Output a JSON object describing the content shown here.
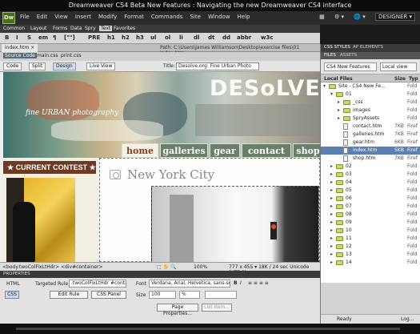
{
  "window": {
    "title": "Dreamweaver CS4 Beta New Features : Navigating the new Dreamweaver CS4 interface"
  },
  "menubar": {
    "logo": "Dw",
    "items": [
      "File",
      "Edit",
      "View",
      "Insert",
      "Modify",
      "Format",
      "Commands",
      "Site",
      "Window",
      "Help"
    ],
    "workspace": "DESIGNER ▾"
  },
  "insert_tabs": [
    "Common",
    "Layout",
    "Forms",
    "Data",
    "Spry",
    "Text",
    "Favorites"
  ],
  "insert_active": "Text",
  "insert_buttons": [
    "B",
    "I",
    "S",
    "em",
    "¶",
    "[\"\"]",
    "PRE",
    "h1",
    "h2",
    "h3",
    "ul",
    "ol",
    "li",
    "dl",
    "dt",
    "dd",
    "abbr",
    "w3c"
  ],
  "document": {
    "tab": "index.htm ×",
    "path": "Path: C:\\Users\\James Williamson\\Desktop\\exercise files\\01 index.htm",
    "related_files": [
      "Source Code",
      "main.css",
      "print.css"
    ],
    "view_buttons": [
      "Code",
      "Split",
      "Design",
      "Live View"
    ],
    "title_label": "Title:",
    "title_value": "Desolve.org: Fine Urban Photo"
  },
  "page": {
    "brand": "DESoLVE",
    "tagline": "fine URBAN photography",
    "nav": [
      "home",
      "galleries",
      "gear",
      "contact",
      "shop"
    ],
    "nav_current": "home",
    "contest_heading": "★ CURRENT CONTEST ★",
    "main_heading": "New York City"
  },
  "statusbar": {
    "tag_selector": "<body.twoColFixLtHdr> <div#container>",
    "zoom": "100%",
    "size": "777 x 455 ▾ 18K / 24 sec Unicode (UTF-8)"
  },
  "properties": {
    "header": "PROPERTIES",
    "html_label": "HTML",
    "css_label": "CSS",
    "targeted_rule_label": "Targeted Rule",
    "targeted_rule_value": ".twoColFixLtHdr #conta",
    "edit_rule": "Edit Rule",
    "css_panel": "CSS Panel",
    "font_label": "Font",
    "font_value": "Verdana, Arial, Helvetica, sans-serif",
    "size_label": "Size",
    "size_value": "100",
    "size_unit": "%",
    "page_properties": "Page Properties...",
    "list_item": "List Item..."
  },
  "panels": {
    "tabs": [
      "CSS STYLES",
      "AP ELEMENTS"
    ],
    "files_tabs": [
      "FILES",
      "ASSETS"
    ],
    "site_select": "CS4 New Features",
    "view_select": "Local view",
    "columns": [
      "Local Files",
      "Size",
      "Typ"
    ],
    "files": [
      {
        "name": "Site - CS4 New Fe...",
        "size": "",
        "type": "Fold",
        "indent": 0,
        "kind": "folder",
        "toggle": "▾"
      },
      {
        "name": "01",
        "size": "",
        "type": "Fold",
        "indent": 1,
        "kind": "folder",
        "toggle": "▾"
      },
      {
        "name": "_css",
        "size": "",
        "type": "Fold",
        "indent": 2,
        "kind": "folder",
        "toggle": "▸"
      },
      {
        "name": "images",
        "size": "",
        "type": "Fold",
        "indent": 2,
        "kind": "folder",
        "toggle": "▸"
      },
      {
        "name": "SpryAssets",
        "size": "",
        "type": "Fold",
        "indent": 2,
        "kind": "folder",
        "toggle": "▸"
      },
      {
        "name": "contact.htm",
        "size": "7KB",
        "type": "Firef",
        "indent": 2,
        "kind": "file",
        "toggle": ""
      },
      {
        "name": "galleries.htm",
        "size": "7KB",
        "type": "Firef",
        "indent": 2,
        "kind": "file",
        "toggle": ""
      },
      {
        "name": "gear.htm",
        "size": "6KB",
        "type": "Firef",
        "indent": 2,
        "kind": "file",
        "toggle": ""
      },
      {
        "name": "index.htm",
        "size": "5KB",
        "type": "Firef",
        "indent": 2,
        "kind": "file",
        "toggle": "",
        "selected": true
      },
      {
        "name": "shop.htm",
        "size": "7KB",
        "type": "Firef",
        "indent": 2,
        "kind": "file",
        "toggle": ""
      },
      {
        "name": "02",
        "size": "",
        "type": "Fold",
        "indent": 1,
        "kind": "folder",
        "toggle": "▸"
      },
      {
        "name": "03",
        "size": "",
        "type": "Fold",
        "indent": 1,
        "kind": "folder",
        "toggle": "▸"
      },
      {
        "name": "04",
        "size": "",
        "type": "Fold",
        "indent": 1,
        "kind": "folder",
        "toggle": "▸"
      },
      {
        "name": "05",
        "size": "",
        "type": "Fold",
        "indent": 1,
        "kind": "folder",
        "toggle": "▸"
      },
      {
        "name": "06",
        "size": "",
        "type": "Fold",
        "indent": 1,
        "kind": "folder",
        "toggle": "▸"
      },
      {
        "name": "07",
        "size": "",
        "type": "Fold",
        "indent": 1,
        "kind": "folder",
        "toggle": "▸"
      },
      {
        "name": "08",
        "size": "",
        "type": "Fold",
        "indent": 1,
        "kind": "folder",
        "toggle": "▸"
      },
      {
        "name": "09",
        "size": "",
        "type": "Fold",
        "indent": 1,
        "kind": "folder",
        "toggle": "▸"
      },
      {
        "name": "10",
        "size": "",
        "type": "Fold",
        "indent": 1,
        "kind": "folder",
        "toggle": "▸"
      },
      {
        "name": "11",
        "size": "",
        "type": "Fold",
        "indent": 1,
        "kind": "folder",
        "toggle": "▸"
      },
      {
        "name": "12",
        "size": "",
        "type": "Fold",
        "indent": 1,
        "kind": "folder",
        "toggle": "▸"
      },
      {
        "name": "13",
        "size": "",
        "type": "Fold",
        "indent": 1,
        "kind": "folder",
        "toggle": "▸"
      },
      {
        "name": "14",
        "size": "",
        "type": "Fold",
        "indent": 1,
        "kind": "folder",
        "toggle": "▸"
      }
    ],
    "status": "Ready",
    "log_button": "Log..."
  },
  "colors": {
    "accent": "#5a7fb3",
    "nav_bg": "#6a7f6a",
    "contest_bg": "#6b3a20",
    "logo_bg": "#4a6b1c"
  }
}
